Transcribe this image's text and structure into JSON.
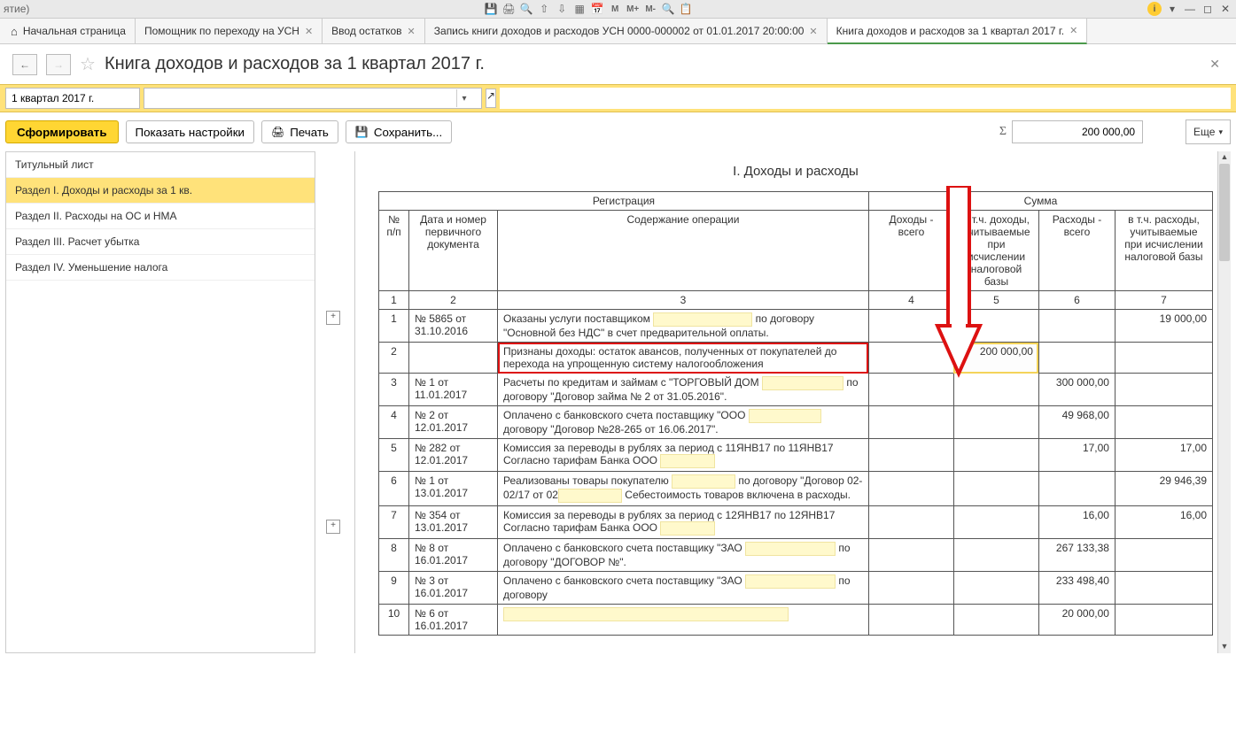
{
  "systembar": {
    "left_text": "ятие)"
  },
  "tabs": [
    {
      "label": "Начальная страница",
      "closable": false,
      "home": true
    },
    {
      "label": "Помощник по переходу на УСН",
      "closable": true
    },
    {
      "label": "Ввод остатков",
      "closable": true
    },
    {
      "label": "Запись книги доходов и расходов УСН 0000-000002 от 01.01.2017 20:00:00",
      "closable": true
    },
    {
      "label": "Книга доходов и расходов за 1 квартал 2017 г.",
      "closable": true,
      "active": true
    }
  ],
  "page_title": "Книга доходов и расходов за 1 квартал 2017 г.",
  "period_field": "1 квартал 2017 г.",
  "toolbar": {
    "form": "Сформировать",
    "show_settings": "Показать настройки",
    "print": "Печать",
    "save": "Сохранить...",
    "more": "Еще",
    "sum_value": "200 000,00"
  },
  "sidebar": {
    "items": [
      "Титульный лист",
      "Раздел I. Доходы и расходы за 1 кв.",
      "Раздел II. Расходы на ОС и НМА",
      "Раздел III. Расчет убытка",
      "Раздел IV. Уменьшение налога"
    ],
    "selected_index": 1
  },
  "report": {
    "title": "I. Доходы и расходы",
    "headers": {
      "group_reg": "Регистрация",
      "group_sum": "Сумма",
      "num": "№ п/п",
      "doc": "Дата и номер первичного документа",
      "op": "Содержание операции",
      "income_total": "Доходы - всего",
      "income_tax": "в т.ч. доходы, учитываемые при исчислении налоговой базы",
      "expense_total": "Расходы - всего",
      "expense_tax": "в т.ч. расходы, учитываемые при исчислении налоговой базы",
      "colnums": [
        "1",
        "2",
        "3",
        "4",
        "5",
        "6",
        "7"
      ]
    },
    "rows": [
      {
        "n": "1",
        "doc": "№ 5865 от 31.10.2016",
        "op_pre": "Оказаны услуги поставщиком ",
        "op_post": " по договору \"Основной без НДС\" в счет предварительной оплаты.",
        "redact_w": 110,
        "c4": "",
        "c5": "",
        "c6": "",
        "c7": "19 000,00"
      },
      {
        "n": "2",
        "doc": "",
        "op": "Признаны доходы: остаток авансов, полученных от покупателей до перехода на упрощенную систему налогообложения",
        "c4": "",
        "c5": "200 000,00",
        "c6": "",
        "c7": "",
        "highlight": true
      },
      {
        "n": "3",
        "doc": "№ 1 от 11.01.2017",
        "op_pre": "Расчеты по кредитам и займам с \"ТОРГОВЫЙ ДОМ ",
        "op_post": " по договору \"Договор займа № 2 от 31.05.2016\".",
        "redact_w": 90,
        "c4": "",
        "c5": "",
        "c6": "300 000,00",
        "c7": ""
      },
      {
        "n": "4",
        "doc": "№ 2 от 12.01.2017",
        "op_pre": "Оплачено с банковского счета поставщику \"ООО ",
        "op_post": " договору \"Договор №28-265 от 16.06.2017\".",
        "redact_w": 80,
        "c4": "",
        "c5": "",
        "c6": "49 968,00",
        "c7": ""
      },
      {
        "n": "5",
        "doc": "№ 282 от 12.01.2017",
        "op_pre": "Комиссия за переводы в рублях за период с 11ЯНВ17 по 11ЯНВ17 Согласно тарифам Банка ООО ",
        "op_post": "",
        "redact_w": 60,
        "c4": "",
        "c5": "",
        "c6": "17,00",
        "c7": "17,00"
      },
      {
        "n": "6",
        "doc": "№ 1 от 13.01.2017",
        "op_pre": "Реализованы товары покупателю ",
        "op_mid": " по договору \"Договор 02-02/17 от 02",
        "op_post": " Себестоимость товаров включена в расходы.",
        "redact_w": 70,
        "redact_w2": 70,
        "c4": "",
        "c5": "",
        "c6": "",
        "c7": "29 946,39"
      },
      {
        "n": "7",
        "doc": "№ 354 от 13.01.2017",
        "op_pre": "Комиссия за переводы в рублях за период с 12ЯНВ17 по 12ЯНВ17 Согласно тарифам Банка ООО ",
        "op_post": "",
        "redact_w": 60,
        "c4": "",
        "c5": "",
        "c6": "16,00",
        "c7": "16,00"
      },
      {
        "n": "8",
        "doc": "№ 8 от 16.01.2017",
        "op_pre": "Оплачено с банковского счета поставщику \"ЗАО ",
        "op_post": " по договору \"ДОГОВОР №\".",
        "redact_w": 100,
        "c4": "",
        "c5": "",
        "c6": "267 133,38",
        "c7": ""
      },
      {
        "n": "9",
        "doc": "№ 3 от 16.01.2017",
        "op_pre": "Оплачено с банковского счета поставщику \"ЗАО ",
        "op_post": " по договору",
        "redact_w": 100,
        "c4": "",
        "c5": "",
        "c6": "233 498,40",
        "c7": ""
      },
      {
        "n": "10",
        "doc": "№ 6 от 16.01.2017",
        "op_pre": "",
        "op_post": "",
        "redact_w": 320,
        "c4": "",
        "c5": "",
        "c6": "20 000,00",
        "c7": ""
      }
    ]
  }
}
